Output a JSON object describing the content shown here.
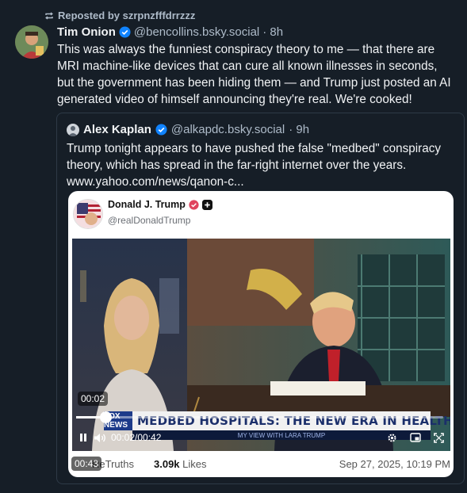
{
  "repost": {
    "label": "Reposted by szrpnzfffdrrzzz"
  },
  "post": {
    "author_name": "Tim Onion",
    "handle": "@bencollins.bsky.social",
    "time": "· 8h",
    "text": "This was always the funniest conspiracy theory to me — that there are MRI machine-like devices that can cure all known illnesses in seconds, but the government has been hiding them — and Trump just posted an AI generated video of himself announcing they're real. We're cooked!"
  },
  "quote": {
    "author_name": "Alex Kaplan",
    "handle": "@alkapdc.bsky.social",
    "time": "· 9h",
    "text": "Trump tonight appears to have pushed the false \"medbed\" conspiracy theory, which has spread in the far-right internet over the years. www.yahoo.com/news/qanon-c...",
    "embed": {
      "author_name": "Donald J. Trump",
      "handle": "@realDonaldTrump",
      "video": {
        "elapsed_pill": "00:02",
        "chyron": "MEDBED HOSPITALS: THE NEW ERA IN HEALTHCARE",
        "chyron_tag": "FOX NEWS",
        "chyron_sub": "MY VIEW   WITH LARA TRUMP",
        "time_display": "00:02/00:42",
        "progress": 0.05
      },
      "duration_pill": "00:43",
      "retruths_label": "ReTruths",
      "likes_count": "3.09k",
      "likes_label": "Likes",
      "date": "Sep 27, 2025, 10:19 PM"
    }
  },
  "colors": {
    "background": "#161e27",
    "verified": "#1083fe",
    "muted": "#aebbc9"
  }
}
